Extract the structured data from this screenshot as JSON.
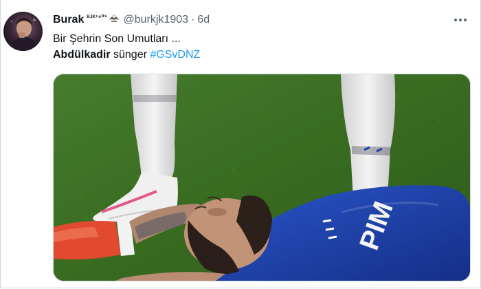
{
  "tweet": {
    "display_name": "Burak",
    "name_suffix": "ᴮᴶᴷ¹⁹⁰³",
    "badge_icon": "eagle-emoji",
    "handle": "@burkjk1903",
    "separator": "·",
    "time": "6d",
    "line1": "Bir Şehrin Son Umutları ...",
    "line2_bold": "Abdülkadir",
    "line2_text": " sünger ",
    "hashtag": "#GSvDNZ",
    "more_icon": "more-horizontal-icon"
  },
  "colors": {
    "text": "#0f1419",
    "secondary": "#536471",
    "link": "#1d9bf0",
    "border": "#cfd9de",
    "pitch_green": "#3f7326",
    "jersey_blue": "#1d3fa8"
  }
}
